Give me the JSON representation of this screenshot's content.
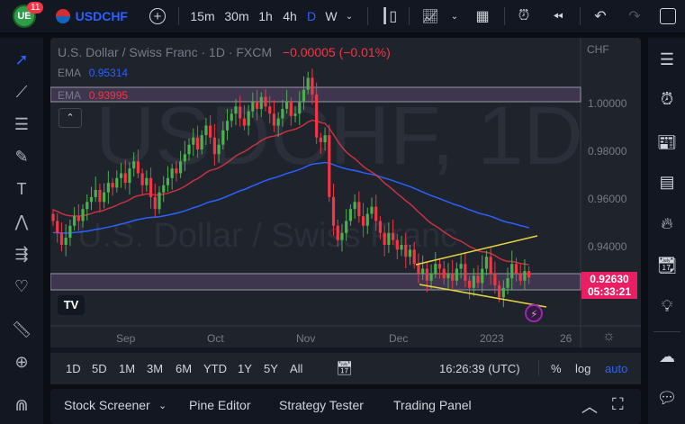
{
  "header": {
    "badge_count": "11",
    "symbol": "USDCHF",
    "intervals": [
      "15m",
      "30m",
      "1h",
      "4h",
      "D",
      "W"
    ],
    "active_interval": "D"
  },
  "legend": {
    "title": "U.S. Dollar / Swiss Franc · 1D · FXCM",
    "change": "−0.00005 (−0.01%)",
    "ema1_label": "EMA",
    "ema1_value": "0.95314",
    "ema2_label": "EMA",
    "ema2_value": "0.93995"
  },
  "watermark": {
    "ticker": "USDCHF, 1D",
    "name": "U.S. Dollar / Swiss Franc"
  },
  "price_axis": {
    "currency": "CHF",
    "ticks": [
      "1.00000",
      "0.98000",
      "0.96000",
      "0.94000"
    ],
    "last_price": "0.92630",
    "countdown": "05:33:21"
  },
  "time_axis": {
    "labels": [
      "Sep",
      "Oct",
      "Nov",
      "Dec",
      "2023",
      "26"
    ]
  },
  "range_bar": {
    "ranges": [
      "1D",
      "5D",
      "1M",
      "3M",
      "6M",
      "YTD",
      "1Y",
      "5Y",
      "All"
    ],
    "clock": "16:26:39 (UTC)",
    "percent": "%",
    "log": "log",
    "auto": "auto"
  },
  "bottom_panel": {
    "tabs": [
      "Stock Screener",
      "Pine Editor",
      "Strategy Tester",
      "Trading Panel"
    ]
  },
  "colors": {
    "up": "#4caf50",
    "down": "#f23645",
    "ema_fast": "#f23645",
    "ema_slow": "#2962ff",
    "accent": "#2962ff",
    "price_tag": "#e91e63",
    "trend": "#e6d444"
  },
  "chart_data": {
    "type": "candlestick",
    "ylim": [
      0.905,
      1.02
    ],
    "closes": [
      0.95,
      0.945,
      0.94,
      0.943,
      0.948,
      0.952,
      0.95,
      0.955,
      0.958,
      0.96,
      0.963,
      0.958,
      0.962,
      0.966,
      0.964,
      0.968,
      0.97,
      0.966,
      0.972,
      0.975,
      0.97,
      0.965,
      0.968,
      0.96,
      0.955,
      0.962,
      0.965,
      0.968,
      0.972,
      0.97,
      0.975,
      0.978,
      0.982,
      0.985,
      0.98,
      0.986,
      0.99,
      0.985,
      0.978,
      0.982,
      0.988,
      0.992,
      0.995,
      0.998,
      0.993,
      0.99,
      0.996,
      1.0,
      0.997,
      1.002,
      0.998,
      0.995,
      0.99,
      0.993,
      0.997,
      1.0,
      0.994,
      0.995,
      1.0,
      1.005,
      1.01,
      1.003,
      0.985,
      0.983,
      0.986,
      0.96,
      0.948,
      0.942,
      0.945,
      0.95,
      0.955,
      0.958,
      0.952,
      0.948,
      0.953,
      0.956,
      0.95,
      0.945,
      0.94,
      0.945,
      0.942,
      0.938,
      0.94,
      0.935,
      0.938,
      0.932,
      0.928,
      0.93,
      0.925,
      0.928,
      0.932,
      0.93,
      0.926,
      0.928,
      0.925,
      0.93,
      0.932,
      0.925,
      0.922,
      0.927,
      0.924,
      0.93,
      0.935,
      0.928,
      0.923,
      0.918,
      0.922,
      0.926,
      0.932,
      0.928,
      0.925,
      0.929,
      0.9263
    ]
  }
}
